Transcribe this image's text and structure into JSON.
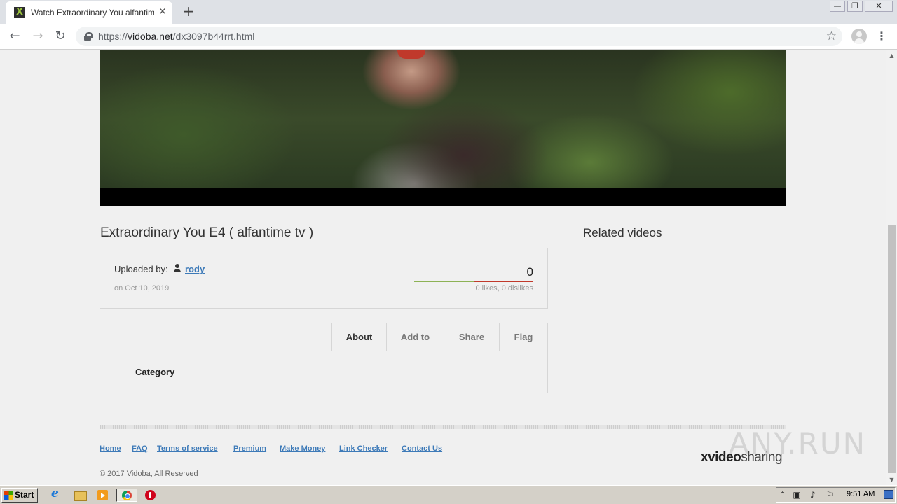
{
  "browser": {
    "tab": {
      "title": "Watch Extraordinary You alfantime",
      "close": "✕"
    },
    "new_tab": "+",
    "window_controls": {
      "minimize": "—",
      "restore": "❐",
      "close": "✕"
    },
    "nav": {
      "back": "←",
      "forward": "→",
      "reload": "↻"
    },
    "url": {
      "scheme": "https://",
      "host": "vidoba.net",
      "path": "/dx3097b44rrt.html"
    },
    "star": "☆",
    "menu": "⋮"
  },
  "video": {
    "title": "Extraordinary You E4 ( alfantime tv )",
    "uploaded_label": "Uploaded by:",
    "uploader": "rody",
    "upload_date": "on Oct 10, 2019",
    "rating": {
      "count": "0",
      "text": "0 likes, 0 dislikes",
      "like_fraction": 0.5
    },
    "colors": {
      "likes": "#8db255",
      "dislikes": "#c0392b",
      "link": "#3d7ab8"
    }
  },
  "tabs": [
    {
      "label": "About",
      "active": true
    },
    {
      "label": "Add to",
      "active": false
    },
    {
      "label": "Share",
      "active": false
    },
    {
      "label": "Flag",
      "active": false
    }
  ],
  "about_panel": {
    "category_label": "Category"
  },
  "related": {
    "title": "Related videos"
  },
  "footer": {
    "links": [
      "Home",
      "FAQ",
      "Terms of service",
      "Premium",
      "Make Money",
      "Link Checker",
      "Contact Us"
    ],
    "copyright": "© 2017 Vidoba, All Reserved",
    "brand": {
      "part1": "xvideo",
      "part2": "sharing"
    }
  },
  "watermark": "ANY.RUN",
  "taskbar": {
    "start_label": "Start",
    "apps": [
      "ie-icon",
      "folder-icon",
      "media-player-icon",
      "chrome-icon",
      "opera-icon"
    ],
    "tray_icons": [
      "chevron-up-icon",
      "network-icon",
      "volume-icon",
      "flag-icon"
    ],
    "clock": "9:51 AM"
  }
}
